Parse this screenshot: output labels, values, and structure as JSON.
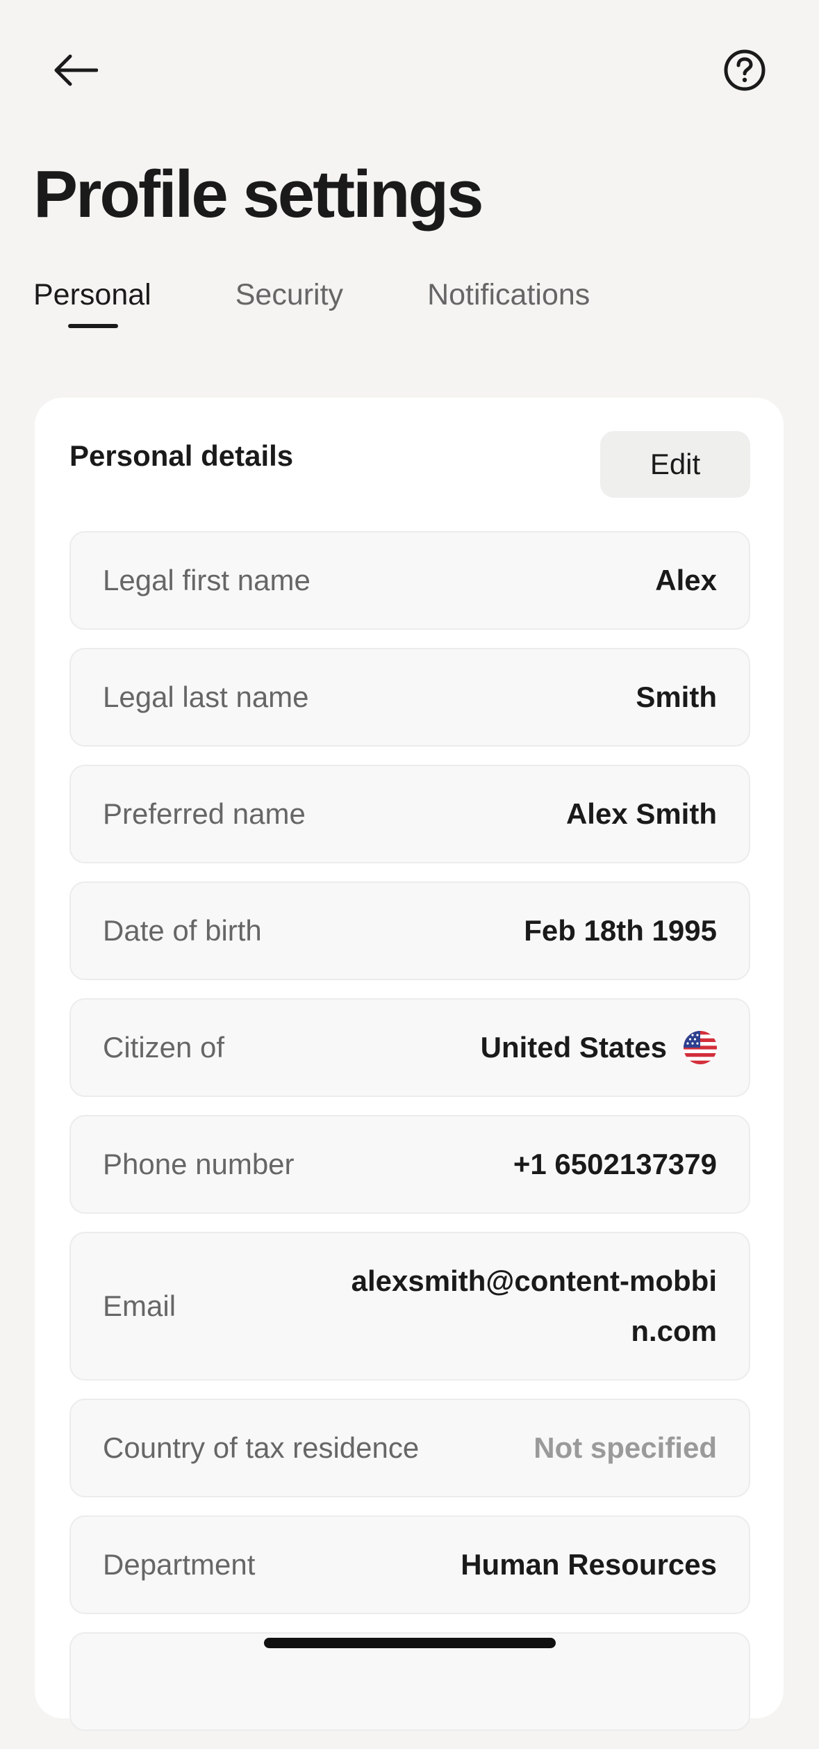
{
  "header": {
    "back_icon": "arrow-left-icon",
    "help_icon": "question-circle-icon",
    "title": "Profile settings"
  },
  "tabs": [
    {
      "label": "Personal",
      "active": true
    },
    {
      "label": "Security",
      "active": false
    },
    {
      "label": "Notifications",
      "active": false
    }
  ],
  "card": {
    "title": "Personal details",
    "edit_label": "Edit",
    "fields": [
      {
        "label": "Legal first name",
        "value": "Alex"
      },
      {
        "label": "Legal last name",
        "value": "Smith"
      },
      {
        "label": "Preferred name",
        "value": "Alex Smith"
      },
      {
        "label": "Date of birth",
        "value": "Feb 18th 1995"
      },
      {
        "label": "Citizen of",
        "value": "United States",
        "icon": "us-flag-icon"
      },
      {
        "label": "Phone number",
        "value": "+1 6502137379"
      },
      {
        "label": "Email",
        "value": "alexsmith@content-mobbin.com"
      },
      {
        "label": "Country of tax residence",
        "value": "Not specified",
        "muted": true
      },
      {
        "label": "Department",
        "value": "Human Resources"
      }
    ]
  },
  "colors": {
    "background": "#f5f4f2",
    "card": "#ffffff",
    "field_bg": "#f8f8f8",
    "text_primary": "#1a1a1a",
    "text_secondary": "#666666",
    "text_muted": "#9a9a9a"
  }
}
